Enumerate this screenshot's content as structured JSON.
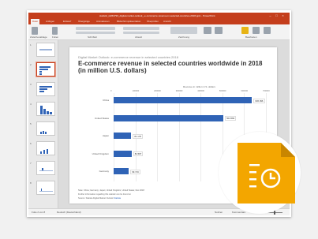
{
  "window": {
    "title": "statistic_id263793_digital-market-outlook_-e-commerce-revenue-in-selected-countries-2018.pptx - PowerPoint"
  },
  "menu": {
    "items": [
      "Datei",
      "Anfügen",
      "Entwurf",
      "Übergänge",
      "Animationen",
      "Bildschirmpräsentation",
      "Überprüfen",
      "Ansicht"
    ]
  },
  "ribbon": {
    "groups": [
      "Zwischenablage",
      "Folien",
      "Schriftart",
      "Absatz",
      "Zeichnung",
      "Bearbeiten"
    ]
  },
  "thumbnails": [
    {
      "num": "1"
    },
    {
      "num": "2"
    },
    {
      "num": "3"
    },
    {
      "num": "4"
    },
    {
      "num": "5"
    },
    {
      "num": "6"
    },
    {
      "num": "7"
    },
    {
      "num": "8"
    }
  ],
  "slide": {
    "supertitle": "Digital Market Outlook: e-commerce revenue in selected countries 2018",
    "title": "E-commerce revenue in selected countries worldwide in 2018 (in million U.S. dollars)",
    "note": "Note: China; Germany; Japan; United Kingdom; United States; Dec 2018",
    "further_info": "Further information regarding this statistic can be found on",
    "source_prefix": "Source: Statista Digital Market Outlook",
    "source_link": "Statista"
  },
  "chart_data": {
    "type": "bar",
    "orientation": "horizontal",
    "xlabel": "Revenue in million U.S. dollars",
    "xlim": [
      0,
      700000
    ],
    "xticks": [
      "0",
      "100000",
      "200000",
      "300000",
      "400000",
      "500000",
      "600000",
      "700000"
    ],
    "categories": [
      "China",
      "United States",
      "Japan",
      "United Kingdom",
      "Germany"
    ],
    "values": [
      636096,
      504582,
      81178,
      82587,
      69716
    ],
    "data_labels": [
      "636.096",
      "504.582",
      "81.178",
      "82.587",
      "69.716"
    ],
    "bar_color": "#2f63b6",
    "grid": true
  },
  "status": {
    "slide_info": "Folie 2 von 8",
    "language": "Deutsch (Deutschland)",
    "notes": "Notizen",
    "comments": "Kommentare"
  },
  "colors": {
    "brand": "#c43e1c",
    "badge": "#f3a600"
  },
  "badge": {
    "icon": "report-document-icon"
  }
}
